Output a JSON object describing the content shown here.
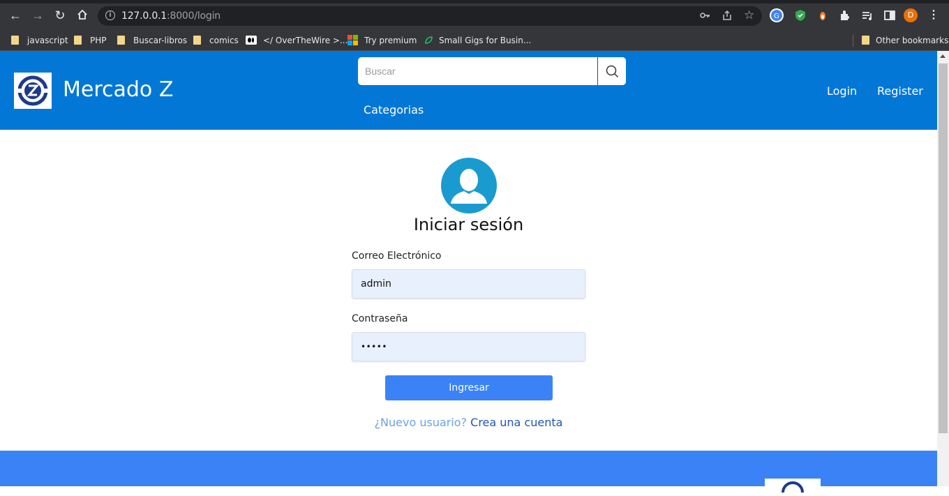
{
  "browser": {
    "url_host": "127.0.0.1",
    "url_path": ":8000/login",
    "profile_initial": "D",
    "bookmarks": [
      {
        "label": "javascript",
        "icon": "folder-icon"
      },
      {
        "label": "PHP",
        "icon": "folder-icon"
      },
      {
        "label": "Buscar-libros",
        "icon": "folder-icon"
      },
      {
        "label": "comics",
        "icon": "folder-icon"
      },
      {
        "label": "</ OverTheWire >...",
        "icon": "medium-icon"
      },
      {
        "label": "Try premium",
        "icon": "microsoft-icon"
      },
      {
        "label": "Small Gigs for Busin...",
        "icon": "leaf-icon"
      }
    ],
    "other_bookmarks": "Other bookmarks"
  },
  "header": {
    "brand": "Mercado Z",
    "search_placeholder": "Buscar",
    "categories_label": "Categorias",
    "login_label": "Login",
    "register_label": "Register"
  },
  "login": {
    "title": "Iniciar sesión",
    "email_label": "Correo Electrónico",
    "email_value": "admin",
    "password_label": "Contraseña",
    "password_value": "•••••",
    "submit_label": "Ingresar",
    "new_user_question": "¿Nuevo usuario?",
    "new_user_link": "Crea una cuenta"
  },
  "colors": {
    "header_bg": "#0277d5",
    "button_bg": "#3b82f6",
    "avatar_bg": "#1a9bd0",
    "field_bg": "#e8f0fe"
  }
}
